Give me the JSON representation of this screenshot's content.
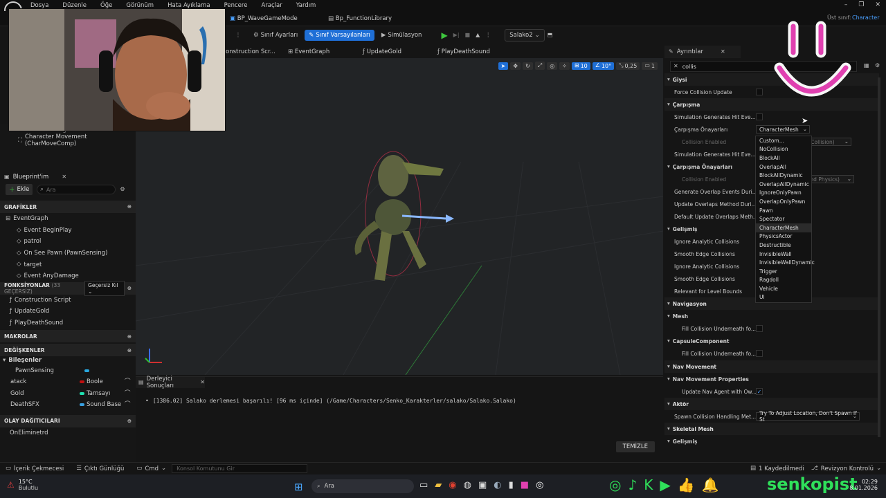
{
  "menu": [
    "Dosya",
    "Düzenle",
    "Öğe",
    "Görünüm",
    "Hata Ayıklama",
    "Pencere",
    "Araçlar",
    "Yardım"
  ],
  "parent_class": {
    "label": "Üst sınıf:",
    "value": "Character"
  },
  "doc_tabs": [
    "BP_WaveGameMode",
    "Bp_FunctionLibrary"
  ],
  "toolbar": {
    "class_settings": "Sınıf Ayarları",
    "class_defaults": "Sınıf Varsayılanları",
    "simulation": "Simülasyon",
    "debug_target": "Salako2"
  },
  "graph_tabs": [
    "onstruction Scr...",
    "EventGraph",
    "UpdateGold",
    "PlayDeathSound"
  ],
  "viewport_tools": {
    "grid": "10",
    "angle": "10°",
    "scale": "0,25",
    "camera": "1"
  },
  "components": {
    "partial": "PawnSensing",
    "movement": "Character Movement (CharMoveComp)"
  },
  "blueprint": {
    "title": "Blueprint'im",
    "add_label": "Ekle",
    "search_placeholder": "Ara",
    "graphs_header": "GRAFİKLER",
    "graphs": [
      "EventGraph",
      "Event BeginPlay",
      "patrol",
      "On See Pawn (PawnSensing)",
      "target",
      "Event AnyDamage"
    ],
    "functions_header": "FONKSİYONLAR",
    "functions_count": "(33 GEÇERSİZ)",
    "override_label": "Geçersiz Kıl",
    "functions": [
      "Construction Script",
      "UpdateGold",
      "PlayDeathSound"
    ],
    "macros_header": "MAKROLAR",
    "variables_header": "DEĞİŞKENLER",
    "components_label": "Bileşenler",
    "variables": [
      {
        "name": "PawnSensing",
        "type": "",
        "color": "#29a8e0"
      },
      {
        "name": "atack",
        "type": "Boole",
        "color": "#c01010"
      },
      {
        "name": "Gold",
        "type": "Tamsayı",
        "color": "#1fe0b0"
      },
      {
        "name": "DeathSFX",
        "type": "Sound Base",
        "color": "#3aa0e0"
      }
    ],
    "dispatchers_header": "OLAY DAĞITICILARI",
    "dispatchers": [
      "OnEliminetrd"
    ]
  },
  "compiler": {
    "tab": "Derleyici Sonuçları",
    "message": "[1386.02] Salako derlemesi başarılı! [96 ms içinde] (/Game/Characters/Senko_Karakterler/salako/Salako.Salako)",
    "clear": "TEMİZLE"
  },
  "details": {
    "tab": "Ayrıntılar",
    "search_value": "collis",
    "rows": [
      {
        "label": "Giysi",
        "kind": "head"
      },
      {
        "label": "Force Collision Update",
        "kind": "check",
        "checked": false
      },
      {
        "label": "Çarpışma",
        "kind": "head"
      },
      {
        "label": "Simulation Generates Hit Eve...",
        "kind": "check",
        "checked": false
      },
      {
        "label": "Çarpışma Önayarları",
        "kind": "combo",
        "value": "CharacterMesh"
      },
      {
        "label": "Collision Enabled",
        "kind": "combo-dim",
        "value": "s Collision)"
      },
      {
        "label": "Simulation Generates Hit Eve...",
        "kind": "plain"
      },
      {
        "label": "Çarpışma Önayarları",
        "kind": "sub"
      },
      {
        "label": "Collision Enabled",
        "kind": "combo-dim",
        "value": "y and Physics)"
      },
      {
        "label": "Generate Overlap Events Duri...",
        "kind": "plain"
      },
      {
        "label": "Update Overlaps Method Duri...",
        "kind": "plain"
      },
      {
        "label": "Default Update Overlaps Meth...",
        "kind": "plain"
      },
      {
        "label": "Gelişmiş",
        "kind": "sub"
      },
      {
        "label": "Ignore Analytic Collisions",
        "kind": "plain"
      },
      {
        "label": "Smooth Edge Collisions",
        "kind": "plain"
      },
      {
        "label": "Ignore Analytic Collisions",
        "kind": "plain"
      },
      {
        "label": "Smooth Edge Collisions",
        "kind": "plain"
      },
      {
        "label": "Relevant for Level Bounds",
        "kind": "plain"
      },
      {
        "label": "Navigasyon",
        "kind": "head"
      },
      {
        "label": "Mesh",
        "kind": "sub"
      },
      {
        "label": "Fill Collision Underneath fo...",
        "kind": "check",
        "checked": false
      },
      {
        "label": "CapsuleComponent",
        "kind": "sub"
      },
      {
        "label": "Fill Collision Underneath fo...",
        "kind": "check",
        "checked": false
      },
      {
        "label": "Nav Movement",
        "kind": "head"
      },
      {
        "label": "Nav Movement Properties",
        "kind": "sub"
      },
      {
        "label": "Update Nav Agent with Ow...",
        "kind": "check",
        "checked": true
      },
      {
        "label": "Aktör",
        "kind": "head"
      },
      {
        "label": "Spawn Collision Handling Met...",
        "kind": "combo",
        "value": "Try To Adjust Location, Don't Spawn If St"
      },
      {
        "label": "Skeletal Mesh",
        "kind": "head"
      },
      {
        "label": "Gelişmiş",
        "kind": "sub"
      }
    ]
  },
  "dropdown": {
    "options": [
      "Custom...",
      "NoCollision",
      "BlockAll",
      "OverlapAll",
      "BlockAllDynamic",
      "OverlapAllDynamic",
      "IgnoreOnlyPawn",
      "OverlapOnlyPawn",
      "Pawn",
      "Spectator",
      "CharacterMesh",
      "PhysicsActor",
      "Destructible",
      "InvisibleWall",
      "InvisibleWallDynamic",
      "Trigger",
      "Ragdoll",
      "Vehicle",
      "UI"
    ],
    "selected": "CharacterMesh"
  },
  "statusbar": {
    "content_drawer": "İçerik Çekmecesi",
    "output_log": "Çıktı Günlüğü",
    "cmd": "Cmd",
    "console_placeholder": "Konsol Komutunu Gir",
    "saved": "1 Kaydedilmedi",
    "revision": "Revizyon Kontrolü"
  },
  "taskbar": {
    "temp": "15°C",
    "weather": "Bulutlu",
    "search": "Ara",
    "time": "02:29",
    "date": "8.01.2026",
    "brand": "senkopist"
  },
  "colors": {
    "accent": "#1f6fd6",
    "brand_green": "#2fe05a",
    "overlay_pink": "#e040b0"
  }
}
